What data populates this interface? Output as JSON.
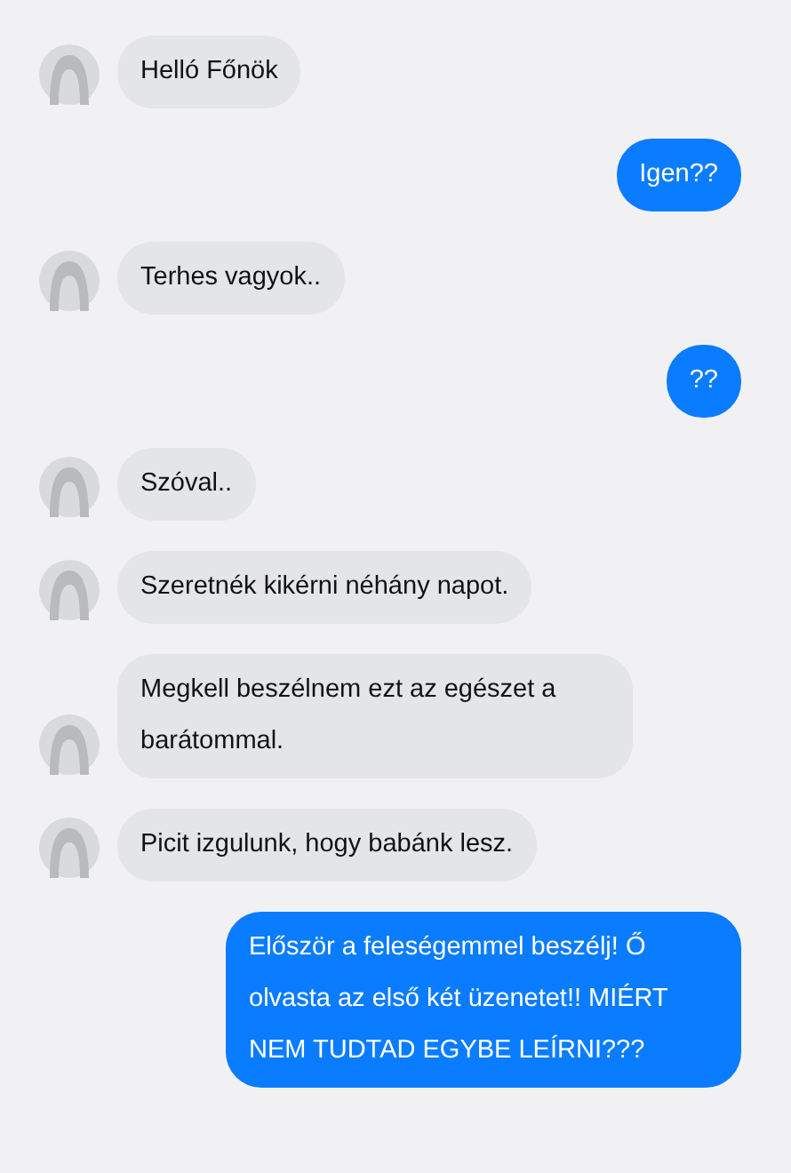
{
  "messages": [
    {
      "kind": "incoming",
      "text": "Helló Főnök"
    },
    {
      "kind": "outgoing",
      "text": "Igen??"
    },
    {
      "kind": "incoming",
      "text": "Terhes vagyok.."
    },
    {
      "kind": "outgoing",
      "text": "??"
    },
    {
      "kind": "incoming",
      "text": "Szóval.."
    },
    {
      "kind": "incoming",
      "text": "Szeretnék kikérni néhány napot."
    },
    {
      "kind": "incoming",
      "text": "Megkell beszélnem ezt az egészet a barátommal."
    },
    {
      "kind": "incoming",
      "text": "Picit izgulunk, hogy babánk lesz."
    },
    {
      "kind": "outgoing",
      "text": "Először a feleségemmel beszélj! Ő olvasta az első két üzenetet!! MIÉRT NEM TUDTAD EGYBE LEÍRNI???"
    }
  ]
}
